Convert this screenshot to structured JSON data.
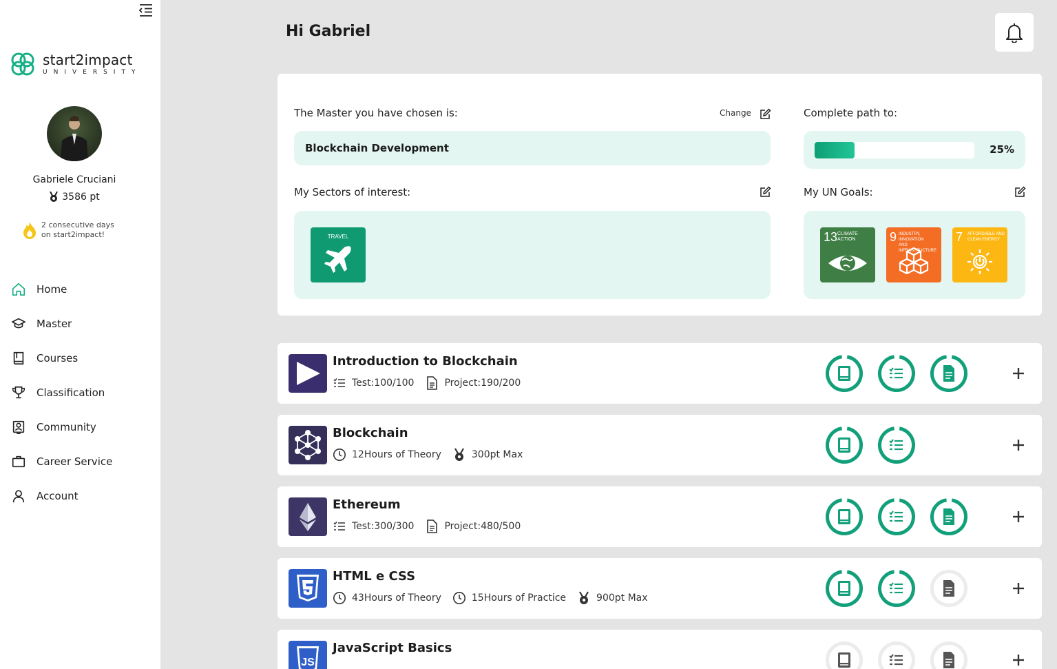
{
  "brand": {
    "name": "start2impact",
    "sub": "UNIVERSITY",
    "accent": "#17b086"
  },
  "user": {
    "name": "Gabriele Cruciani",
    "points": "3586 pt",
    "streak_line1": "2 consecutive days",
    "streak_line2": "on start2impact!"
  },
  "nav": {
    "items": [
      {
        "label": "Home",
        "icon": "home-icon",
        "active": true
      },
      {
        "label": "Master",
        "icon": "graduation-cap-icon"
      },
      {
        "label": "Courses",
        "icon": "book-icon"
      },
      {
        "label": "Classification",
        "icon": "trophy-icon"
      },
      {
        "label": "Community",
        "icon": "contact-icon"
      },
      {
        "label": "Career Service",
        "icon": "briefcase-icon"
      },
      {
        "label": "Account",
        "icon": "user-icon"
      }
    ]
  },
  "header": {
    "greeting": "Hi Gabriel"
  },
  "profile": {
    "master_label": "The Master you have chosen is:",
    "change_label": "Change",
    "master_value": "Blockchain Development",
    "path_label": "Complete path to:",
    "progress_fraction": 0.25,
    "progress_text": "25%",
    "sectors_label": "My Sectors of interest:",
    "sectors": [
      {
        "caption": "TRAVEL",
        "color": "#0f9a72",
        "icon": "airplane-icon"
      }
    ],
    "goals_label": "My UN Goals:",
    "goals": [
      {
        "number": "13",
        "caption1": "CLIMATE",
        "caption2": "ACTION",
        "color": "#3f7e44",
        "icon": "eye-globe-icon"
      },
      {
        "number": "9",
        "caption1": "INDUSTRY, INNOVATION",
        "caption2": "AND INFRASTRUCTURE",
        "color": "#f36d25",
        "icon": "cubes-icon"
      },
      {
        "number": "7",
        "caption1": "AFFORDABLE AND",
        "caption2": "CLEAN ENERGY",
        "color": "#fdb713",
        "icon": "sun-power-icon"
      }
    ]
  },
  "courses": [
    {
      "title": "Introduction to Blockchain",
      "meta": [
        "Test:100/100",
        "Project:190/200"
      ],
      "meta_icons": [
        "list-icon",
        "document-icon"
      ],
      "stages": [
        "done",
        "done",
        "done"
      ]
    },
    {
      "title": "Blockchain",
      "meta": [
        "12Hours of Theory",
        "300pt Max"
      ],
      "meta_icons": [
        "clock-icon",
        "medal-icon"
      ],
      "stages": [
        "done",
        "done"
      ]
    },
    {
      "title": "Ethereum",
      "meta": [
        "Test:300/300",
        "Project:480/500"
      ],
      "meta_icons": [
        "list-icon",
        "document-icon"
      ],
      "stages": [
        "done",
        "done",
        "done"
      ]
    },
    {
      "title": "HTML e CSS",
      "meta": [
        "43Hours of Theory",
        "15Hours of Practice",
        "900pt Max"
      ],
      "meta_icons": [
        "clock-icon",
        "clock-icon",
        "medal-icon"
      ],
      "stages": [
        "done",
        "done",
        "todo"
      ]
    },
    {
      "title": "JavaScript Basics",
      "meta": [],
      "meta_icons": [],
      "stages": [
        "todo",
        "todo",
        "todo"
      ]
    }
  ]
}
